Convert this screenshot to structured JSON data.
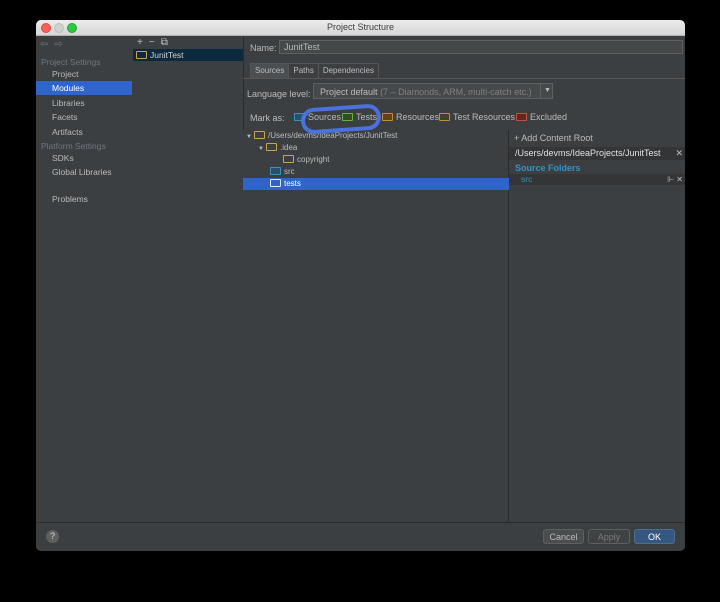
{
  "window": {
    "title": "Project Structure"
  },
  "nav": {
    "project_settings": "Project Settings",
    "items_project": [
      "Project",
      "Modules",
      "Libraries",
      "Facets",
      "Artifacts"
    ],
    "platform_settings": "Platform Settings",
    "items_platform": [
      "SDKs",
      "Global Libraries"
    ],
    "problems": "Problems",
    "selected": "Modules"
  },
  "modules": {
    "toolbar": {
      "add": "+",
      "remove": "−",
      "copy": "⧉"
    },
    "items": [
      "JunitTest"
    ]
  },
  "main": {
    "name_label": "Name:",
    "name_value": "JunitTest",
    "tabs": [
      "Sources",
      "Paths",
      "Dependencies"
    ],
    "active_tab": "Sources",
    "language_label": "Language level:",
    "language_value": "Project default",
    "language_hint": "(7 – Diamonds, ARM, multi-catch etc.)",
    "mark_as_label": "Mark as:",
    "mark_as": [
      "Sources",
      "Tests",
      "Resources",
      "Test Resources",
      "Excluded"
    ]
  },
  "tree": {
    "rows": [
      {
        "label": "/Users/devms/IdeaProjects/JunitTest",
        "expanded": true,
        "depth": 0
      },
      {
        "label": ".idea",
        "expanded": true,
        "depth": 1
      },
      {
        "label": "copyright",
        "depth": 2
      },
      {
        "label": "src",
        "depth": 1
      },
      {
        "label": "tests",
        "depth": 1,
        "selected": true
      }
    ]
  },
  "content_root": {
    "add_label": "+ Add Content Root",
    "root_path": "/Users/devms/IdeaProjects/JunitTest",
    "source_folders_label": "Source Folders",
    "source_items": [
      "src"
    ]
  },
  "footer": {
    "help": "?",
    "cancel": "Cancel",
    "apply": "Apply",
    "ok": "OK"
  },
  "colors": {
    "selection": "#2f65ca",
    "sources_blue": "#3592c4",
    "annotation_circle": "#4d74e6"
  }
}
